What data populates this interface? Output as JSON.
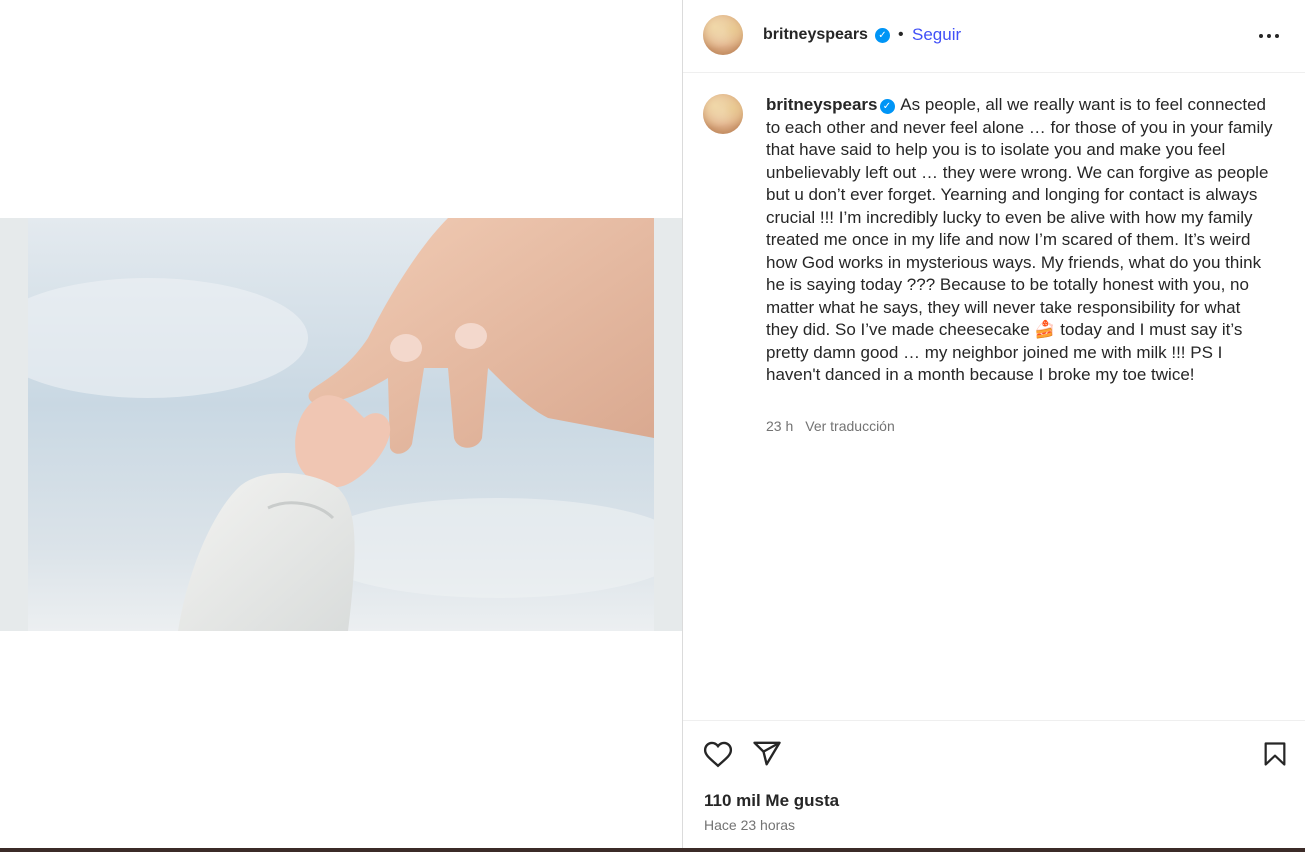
{
  "post": {
    "author": "britneyspears",
    "follow_label": "Seguir",
    "separator": "•",
    "more_label": "Más opciones",
    "caption_text": "As people, all we really want is to feel connected to each other and never feel alone … for those of you in your family that have said to help you is to isolate you and make you feel unbelievably left out … they were wrong. We can forgive as people but u don’t ever forget. Yearning and longing for contact is always crucial !!! I’m incredibly lucky to even be alive with how my family treated me once in my life and now I’m scared of them. It’s weird how God works in mysterious ways. My friends, what do you think he is saying today ??? Because to be totally honest with you, no matter what he says, they will never take responsibility for what they did. So I’ve made cheesecake 🍰 today and I must say it’s pretty damn good … my neighbor joined me with milk !!! PS I haven't danced in a month because I broke my toe twice!",
    "caption_age": "23 h",
    "translate_label": "Ver traducción",
    "likes": "110 mil Me gusta",
    "posted_ago": "Hace 23 horas"
  },
  "colors": {
    "accent": "#4150f7",
    "verified": "#0095f6",
    "text_primary": "#262626",
    "text_secondary": "#737373"
  },
  "icons": {
    "more": "more-horizontal-icon",
    "like": "heart-icon",
    "share": "paper-plane-icon",
    "save": "bookmark-icon",
    "verified": "verified-badge-icon"
  }
}
